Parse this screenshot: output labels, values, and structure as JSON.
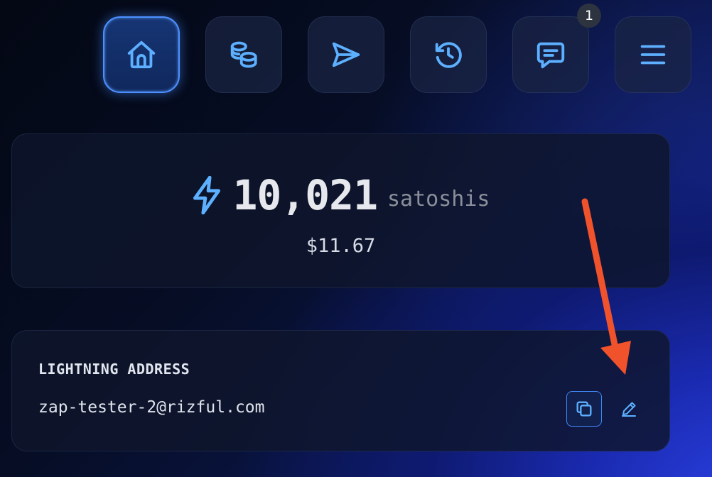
{
  "nav": {
    "items": [
      {
        "icon": "home-icon",
        "active": true
      },
      {
        "icon": "coins-icon",
        "active": false
      },
      {
        "icon": "send-icon",
        "active": false
      },
      {
        "icon": "history-icon",
        "active": false
      },
      {
        "icon": "message-icon",
        "active": false,
        "badge": "1"
      },
      {
        "icon": "menu-icon",
        "active": false
      }
    ]
  },
  "balance": {
    "icon": "lightning-bolt-icon",
    "amount": "10,021",
    "unit": "satoshis",
    "fiat": "$11.67"
  },
  "lightning_address": {
    "label": "LIGHTNING ADDRESS",
    "value": "zap-tester-2@rizful.com",
    "copy_icon": "copy-icon",
    "edit_icon": "edit-pencil-icon"
  },
  "colors": {
    "accent": "#5db0ff",
    "active_border": "#4d8fff",
    "annotation_arrow": "#f0522c",
    "card_bg": "#0f162c"
  }
}
